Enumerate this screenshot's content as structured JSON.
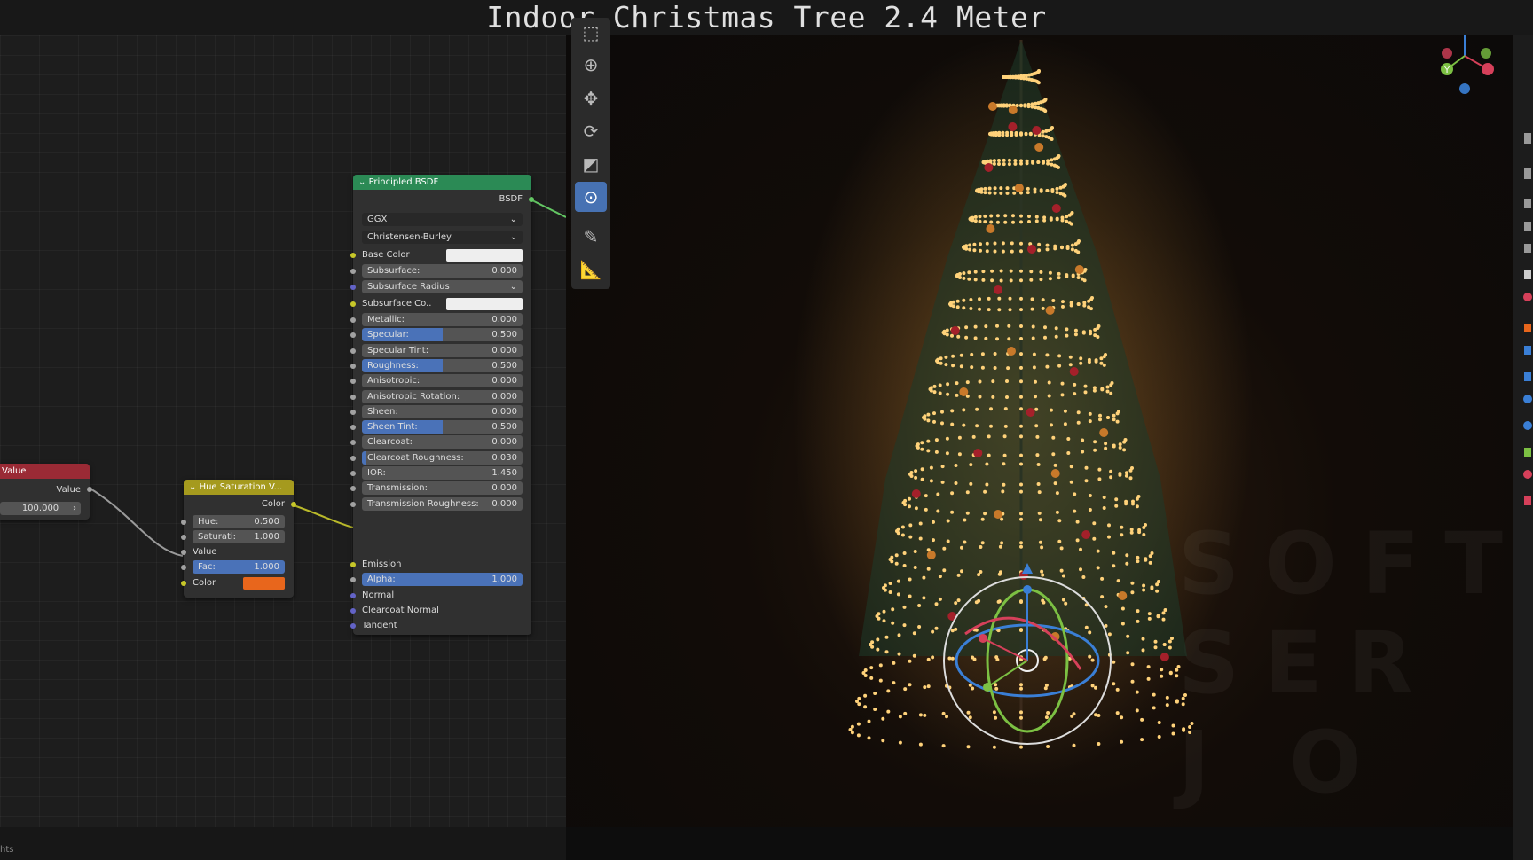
{
  "window": {
    "title": "Indoor Christmas Tree 2.4 Meter"
  },
  "status_bar": {
    "left_text": "hts"
  },
  "nodes": {
    "value": {
      "header": "Value",
      "output_label": "Value",
      "value": "100.000"
    },
    "hue_saturation": {
      "header": "Hue Saturation V...",
      "output_label": "Color",
      "fields": [
        {
          "label": "Hue:",
          "value": "0.500"
        },
        {
          "label": "Saturati:",
          "value": "1.000"
        }
      ],
      "value_label": "Value",
      "fac": {
        "label": "Fac:",
        "value": "1.000"
      },
      "color_label": "Color",
      "color_swatch": "#e8661c"
    },
    "principled": {
      "header": "Principled BSDF",
      "output_label": "BSDF",
      "distribution": "GGX",
      "subsurface_method": "Christensen-Burley",
      "base_color_label": "Base Color",
      "subsurface": {
        "label": "Subsurface:",
        "value": "0.000"
      },
      "subsurface_radius": "Subsurface Radius",
      "subsurface_color_label": "Subsurface Co..",
      "fields": [
        {
          "label": "Metallic:",
          "value": "0.000",
          "fill": 0
        },
        {
          "label": "Specular:",
          "value": "0.500",
          "fill": 0.5
        },
        {
          "label": "Specular Tint:",
          "value": "0.000",
          "fill": 0
        },
        {
          "label": "Roughness:",
          "value": "0.500",
          "fill": 0.5
        },
        {
          "label": "Anisotropic:",
          "value": "0.000",
          "fill": 0
        },
        {
          "label": "Anisotropic Rotation:",
          "value": "0.000",
          "fill": 0
        },
        {
          "label": "Sheen:",
          "value": "0.000",
          "fill": 0
        },
        {
          "label": "Sheen Tint:",
          "value": "0.500",
          "fill": 0.5
        },
        {
          "label": "Clearcoat:",
          "value": "0.000",
          "fill": 0
        },
        {
          "label": "Clearcoat Roughness:",
          "value": "0.030",
          "fill": 0.03
        },
        {
          "label": "IOR:",
          "value": "1.450",
          "fill": 0
        },
        {
          "label": "Transmission:",
          "value": "0.000",
          "fill": 0
        },
        {
          "label": "Transmission Roughness:",
          "value": "0.000",
          "fill": 0
        }
      ],
      "emission_label": "Emission",
      "alpha": {
        "label": "Alpha:",
        "value": "1.000",
        "fill": 1
      },
      "normal_label": "Normal",
      "clearcoat_normal_label": "Clearcoat Normal",
      "tangent_label": "Tangent"
    }
  },
  "viewport": {
    "watermark_lines": [
      "SOFT",
      "SER",
      "J O"
    ],
    "gizmo_axes": {
      "z": "Z",
      "y": "Y"
    }
  },
  "colors": {
    "value_header": "#9a2a35",
    "hue_header": "#a59a1e",
    "principled_header": "#2b8a55",
    "accent_blue": "#4a72b8"
  }
}
